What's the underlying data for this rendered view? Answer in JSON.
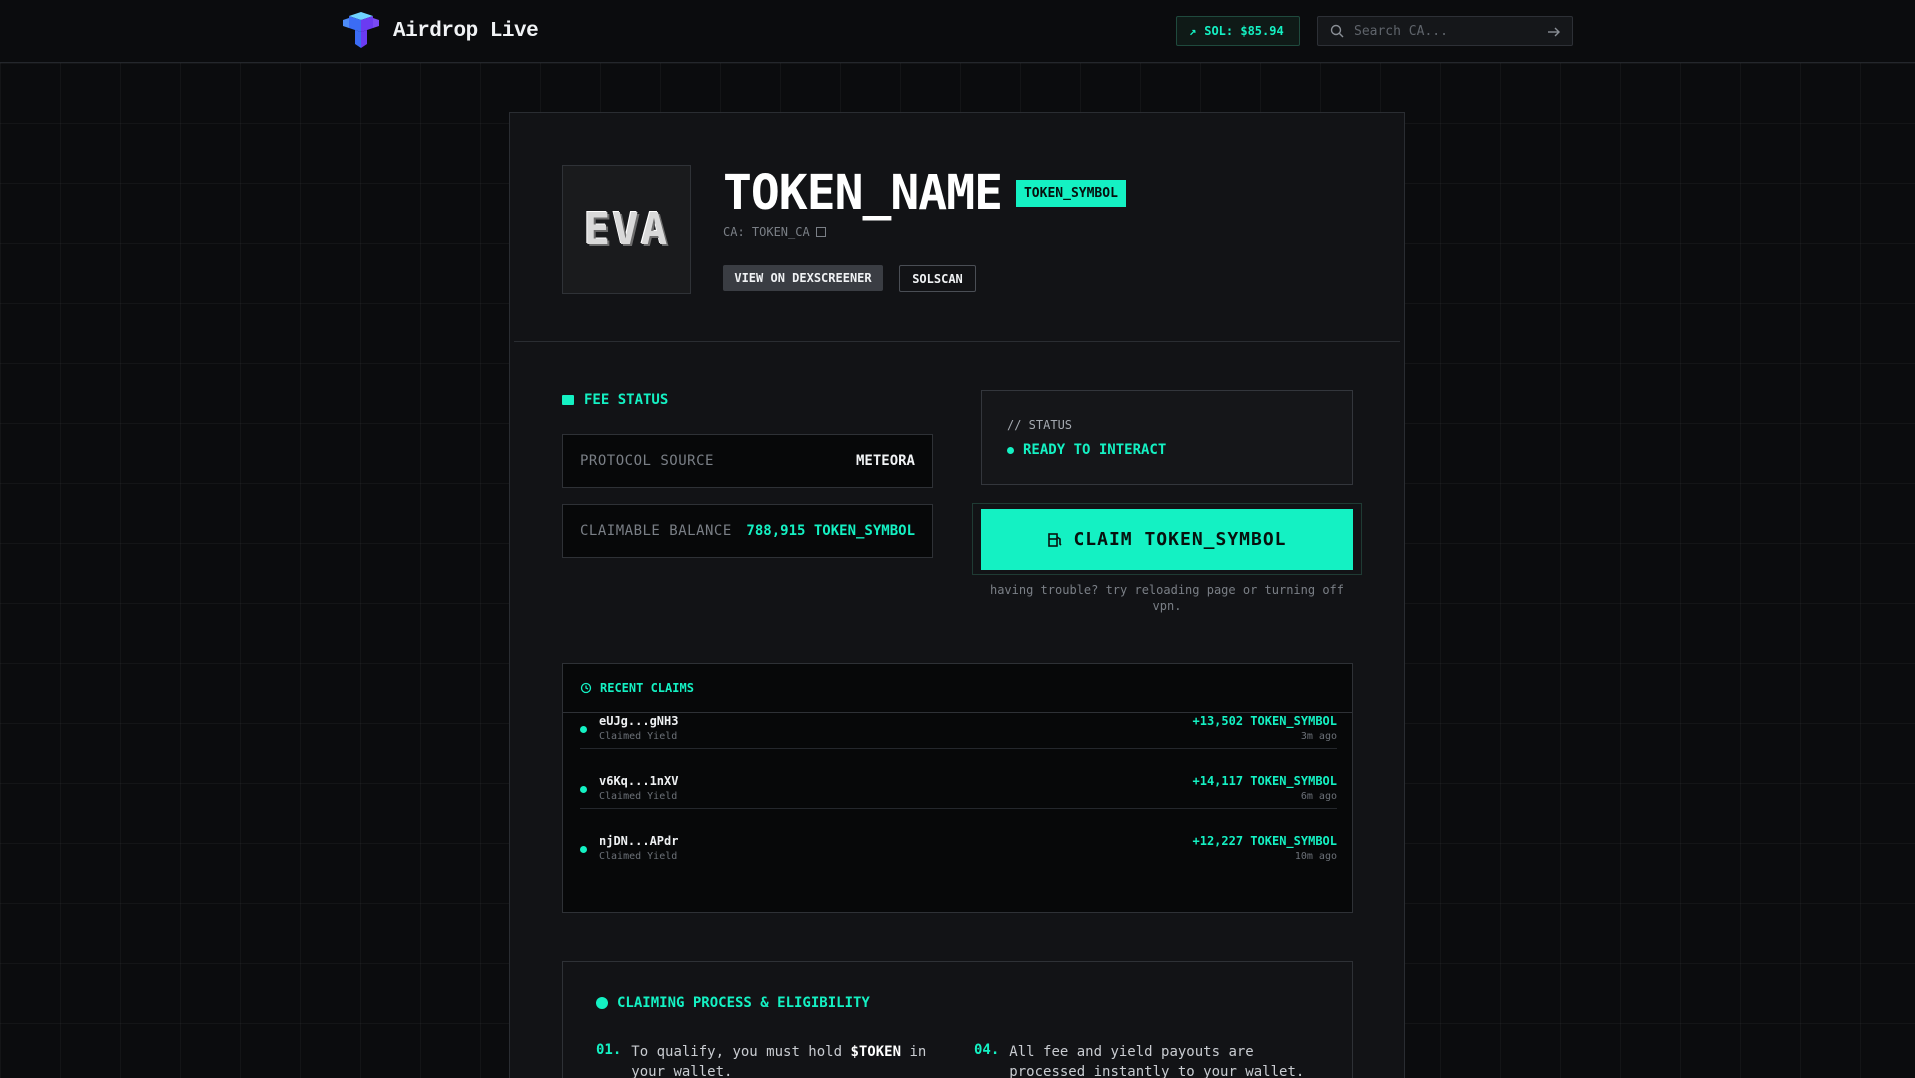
{
  "header": {
    "app_title": "Airdrop Live",
    "sol_price": "SOL: $85.94",
    "search_placeholder": "Search CA..."
  },
  "token": {
    "logo_text": "EVA",
    "name": "TOKEN_NAME",
    "symbol": "TOKEN_SYMBOL",
    "ca": "CA: TOKEN_CA",
    "dex_button": "VIEW ON DEXSCREENER",
    "solscan_button": "SOLSCAN"
  },
  "fee_status": {
    "title": "FEE STATUS",
    "protocol_label": "PROTOCOL SOURCE",
    "protocol_value": "METEORA",
    "balance_label": "CLAIMABLE BALANCE",
    "balance_value": "788,915 TOKEN_SYMBOL"
  },
  "status": {
    "label": "// STATUS",
    "value": "READY TO INTERACT"
  },
  "claim": {
    "button_label": "CLAIM TOKEN_SYMBOL",
    "help_text": "having trouble? try reloading page or turning off vpn."
  },
  "recent_claims": {
    "title": "RECENT CLAIMS",
    "rows": [
      {
        "address": "eUJg...gNH3",
        "label": "Claimed Yield",
        "amount": "+13,502 TOKEN_SYMBOL",
        "ago": "3m ago"
      },
      {
        "address": "v6Kq...1nXV",
        "label": "Claimed Yield",
        "amount": "+14,117 TOKEN_SYMBOL",
        "ago": "6m ago"
      },
      {
        "address": "njDN...APdr",
        "label": "Claimed Yield",
        "amount": "+12,227 TOKEN_SYMBOL",
        "ago": "10m ago"
      }
    ]
  },
  "process": {
    "title": "CLAIMING PROCESS & ELIGIBILITY",
    "steps": [
      {
        "num": "01.",
        "text_before": "To qualify, you must hold ",
        "highlight": "$TOKEN",
        "text_after": " in your wallet."
      },
      {
        "num": "04.",
        "text": "All fee and yield payouts are processed instantly to your wallet."
      }
    ]
  },
  "colors": {
    "accent": "#14f1c3",
    "background": "#0b0c0e",
    "panel": "#121316"
  },
  "icons": [
    "logo-cube-icon",
    "trend-up-icon",
    "search-icon",
    "arrow-right-icon",
    "copy-icon",
    "terminal-icon",
    "fuel-icon",
    "history-icon",
    "info-dot-icon"
  ]
}
